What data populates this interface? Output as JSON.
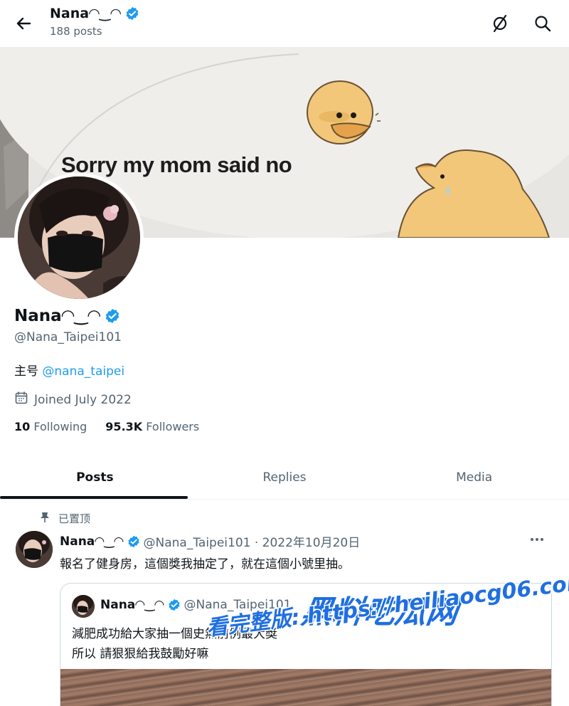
{
  "header": {
    "name": "Nana◠‿◠",
    "posts_count": "188 posts"
  },
  "banner": {
    "caption": "Sorry my mom said no"
  },
  "profile": {
    "name": "Nana◠‿◠",
    "handle": "@Nana_Taipei101",
    "bio_prefix": "主号 ",
    "bio_link": "@nana_taipei",
    "joined": "Joined July 2022",
    "following_count": "10",
    "following_label": "Following",
    "followers_count": "95.3K",
    "followers_label": "Followers"
  },
  "tabs": [
    {
      "label": "Posts",
      "active": true
    },
    {
      "label": "Replies",
      "active": false
    },
    {
      "label": "Media",
      "active": false
    }
  ],
  "pinned_post": {
    "pinned_label": "已置顶",
    "author_name": "Nana◠‿◠",
    "meta": "@Nana_Taipei101 · 2022年10月20日",
    "text": "報名了健身房，這個獎我抽定了，就在這個小號里抽。",
    "more_icon": "more-dots-icon",
    "quote": {
      "author_name": "Nana◠‿◠",
      "handle": "@Nana_Taipei101",
      "line1": "減肥成功給大家抽一個史無前例最大獎",
      "line2": "所以 請狠狠給我鼓勵好嘛"
    }
  },
  "watermark": {
    "brand": "黑料吃瓜网",
    "url_text": "看完整版: https://heiliaocg06.com"
  },
  "colors": {
    "accent": "#1d9bf0",
    "secondary_text": "#536471",
    "primary_text": "#0f1419",
    "verified": "#1d9bf0"
  }
}
